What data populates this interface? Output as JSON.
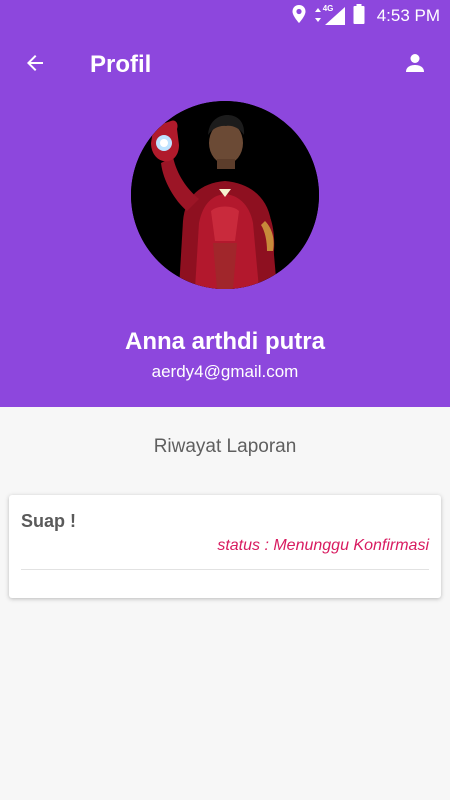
{
  "status_bar": {
    "time": "4:53 PM",
    "network_label": "4G",
    "icons": [
      "location-icon",
      "signal-icon",
      "battery-icon"
    ]
  },
  "app_bar": {
    "title": "Profil",
    "back_icon": "back-arrow-icon",
    "profile_icon": "person-icon"
  },
  "profile": {
    "name": "Anna arthdi putra",
    "email": "aerdy4@gmail.com"
  },
  "history": {
    "section_title": "Riwayat Laporan",
    "reports": [
      {
        "title": "Suap !",
        "status": "status : Menunggu Konfirmasi"
      }
    ]
  },
  "colors": {
    "primary": "#8d47dd",
    "status_text": "#d81b60",
    "background": "#f7f7f7"
  }
}
